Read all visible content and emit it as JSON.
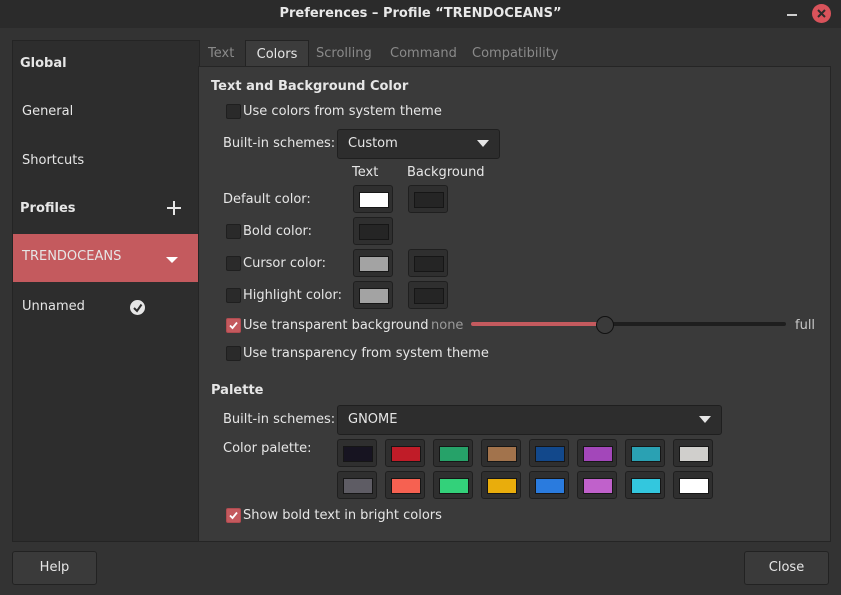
{
  "window": {
    "title": "Preferences – Profile “TRENDOCEANS”"
  },
  "sidebar": {
    "global_header": "Global",
    "general": "General",
    "shortcuts": "Shortcuts",
    "profiles_header": "Profiles",
    "profiles": [
      {
        "label": "TRENDOCEANS",
        "selected": true
      },
      {
        "label": "Unnamed",
        "default": true
      }
    ]
  },
  "tabs": [
    "Text",
    "Colors",
    "Scrolling",
    "Command",
    "Compatibility"
  ],
  "active_tab": "Colors",
  "text_bg": {
    "heading": "Text and Background Color",
    "use_system_colors": {
      "label": "Use colors from system theme",
      "checked": false
    },
    "builtin_label": "Built-in schemes:",
    "builtin_value": "Custom",
    "col_text": "Text",
    "col_background": "Background",
    "default_color": {
      "label": "Default color:",
      "text": "#ffffff",
      "background": "#252525"
    },
    "bold_color": {
      "label": "Bold color:",
      "checked": false,
      "text": "#252525"
    },
    "cursor_color": {
      "label": "Cursor color:",
      "checked": false,
      "text": "#a3a3a3",
      "background": "#252525"
    },
    "highlight_color": {
      "label": "Highlight color:",
      "checked": false,
      "text": "#a3a3a3",
      "background": "#252525"
    },
    "transparent_bg": {
      "label": "Use transparent background",
      "checked": true,
      "min_label": "none",
      "max_label": "full",
      "value_fraction": 0.43
    },
    "transparency_system": {
      "label": "Use transparency from system theme",
      "checked": false
    }
  },
  "palette": {
    "heading": "Palette",
    "builtin_label": "Built-in schemes:",
    "builtin_value": "GNOME",
    "color_palette_label": "Color palette:",
    "row1": [
      "#171421",
      "#c01c28",
      "#26a269",
      "#a2734c",
      "#12488b",
      "#a347ba",
      "#2aa1b3",
      "#d0cfcc"
    ],
    "row2": [
      "#5e5c64",
      "#f66151",
      "#33d17a",
      "#e9ad0c",
      "#2a7bde",
      "#c061cb",
      "#33c7de",
      "#ffffff"
    ],
    "bold_bright": {
      "label": "Show bold text in bright colors",
      "checked": true
    }
  },
  "buttons": {
    "help": "Help",
    "close": "Close"
  },
  "colors": {
    "accent": "#c45a5e"
  }
}
